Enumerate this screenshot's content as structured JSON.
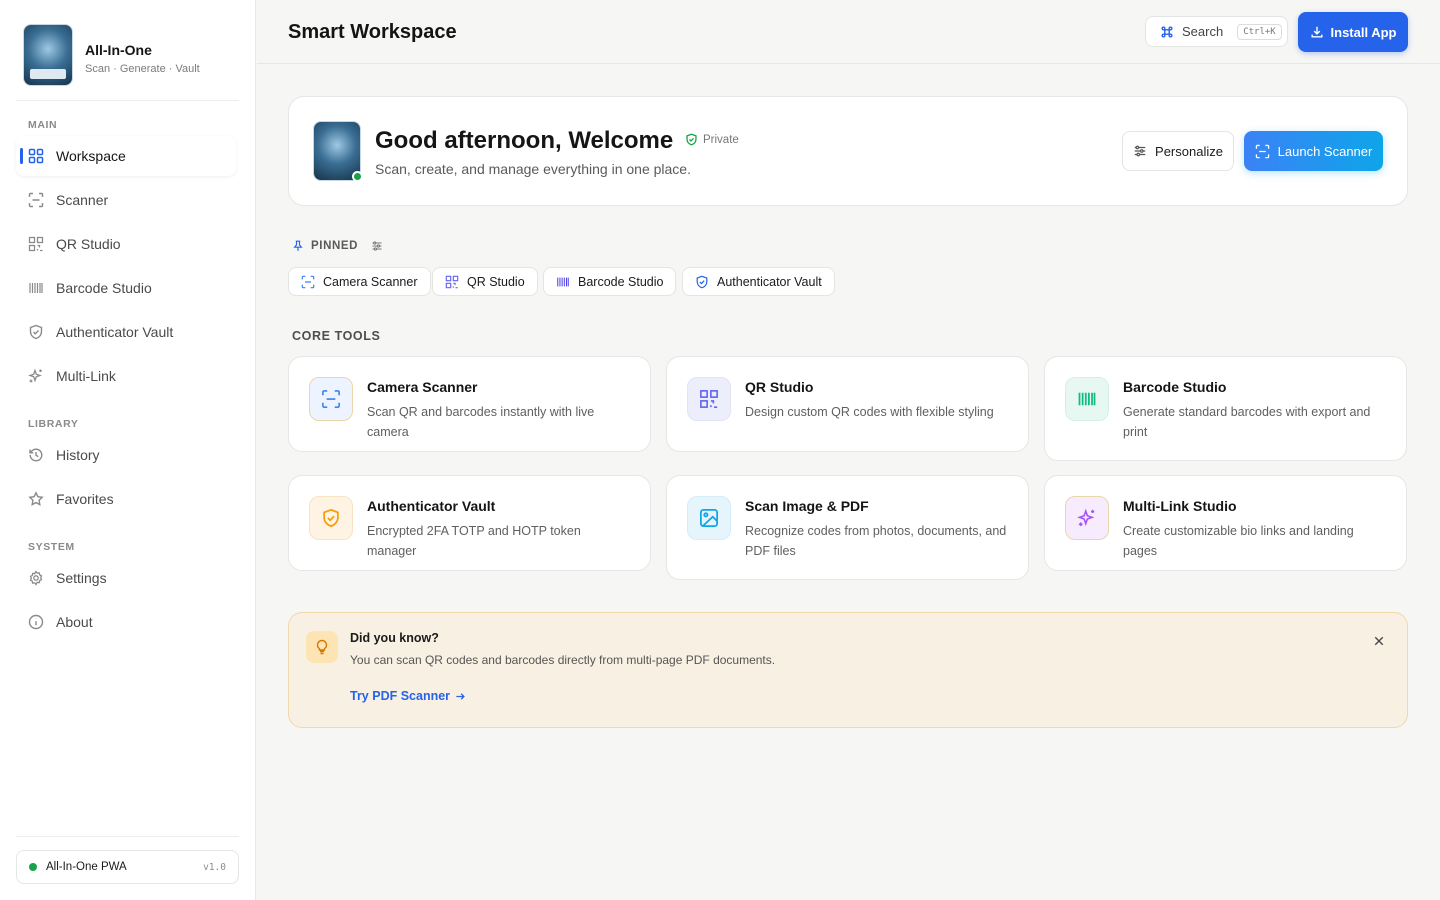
{
  "app": {
    "name": "All-In-One",
    "tagline": "Scan · Generate · Vault",
    "logo_caption": "ALL-IN-ONE"
  },
  "sidebar": {
    "sections": [
      {
        "label": "MAIN",
        "items": [
          {
            "label": "Workspace",
            "icon": "grid-icon",
            "active": true
          },
          {
            "label": "Scanner",
            "icon": "scan-icon"
          },
          {
            "label": "QR Studio",
            "icon": "qr-icon"
          },
          {
            "label": "Barcode Studio",
            "icon": "barcode-icon"
          },
          {
            "label": "Authenticator Vault",
            "icon": "shield-icon"
          },
          {
            "label": "Multi-Link",
            "icon": "sparkles-icon"
          }
        ]
      },
      {
        "label": "LIBRARY",
        "items": [
          {
            "label": "History",
            "icon": "history-icon"
          },
          {
            "label": "Favorites",
            "icon": "star-icon"
          }
        ]
      },
      {
        "label": "SYSTEM",
        "items": [
          {
            "label": "Settings",
            "icon": "gear-icon"
          },
          {
            "label": "About",
            "icon": "info-icon"
          }
        ]
      }
    ],
    "footer": {
      "label": "All-In-One PWA",
      "version": "v1.0"
    }
  },
  "header": {
    "title": "Smart Workspace",
    "search_label": "Search",
    "search_shortcut": "Ctrl+K",
    "install_label": "Install App"
  },
  "welcome": {
    "greeting": "Good afternoon, Welcome",
    "privacy_badge": "Private",
    "subtitle": "Scan, create, and manage everything in one place.",
    "personalize_label": "Personalize",
    "launch_label": "Launch Scanner"
  },
  "pinned": {
    "label": "PINNED",
    "items": [
      {
        "label": "Camera Scanner",
        "icon": "scan-icon"
      },
      {
        "label": "QR Studio",
        "icon": "qr-icon"
      },
      {
        "label": "Barcode Studio",
        "icon": "barcode-icon"
      },
      {
        "label": "Authenticator Vault",
        "icon": "shield-icon"
      }
    ]
  },
  "core_tools": {
    "label": "CORE TOOLS",
    "items": [
      {
        "title": "Camera Scanner",
        "description": "Scan QR and barcodes instantly with live camera",
        "icon": "scan-icon",
        "color": "#3b82f6"
      },
      {
        "title": "QR Studio",
        "description": "Design custom QR codes with flexible styling",
        "icon": "qr-icon",
        "color": "#6366f1"
      },
      {
        "title": "Barcode Studio",
        "description": "Generate standard barcodes with export and print",
        "icon": "barcode-icon",
        "color": "#10b981"
      },
      {
        "title": "Authenticator Vault",
        "description": "Encrypted 2FA TOTP and HOTP token manager",
        "icon": "shield-icon",
        "color": "#f59e0b"
      },
      {
        "title": "Scan Image & PDF",
        "description": "Recognize codes from photos, documents, and PDF files",
        "icon": "image-icon",
        "color": "#0ea5e9"
      },
      {
        "title": "Multi-Link Studio",
        "description": "Create customizable bio links and landing pages",
        "icon": "sparkles-icon",
        "color": "#a855f7"
      }
    ]
  },
  "tip": {
    "title": "Did you know?",
    "text": "You can scan QR codes and barcodes directly from multi-page PDF documents.",
    "link_label": "Try PDF Scanner",
    "icon": "lightbulb-icon"
  },
  "colors": {
    "accent": "#2563eb",
    "online": "#16a34a"
  }
}
